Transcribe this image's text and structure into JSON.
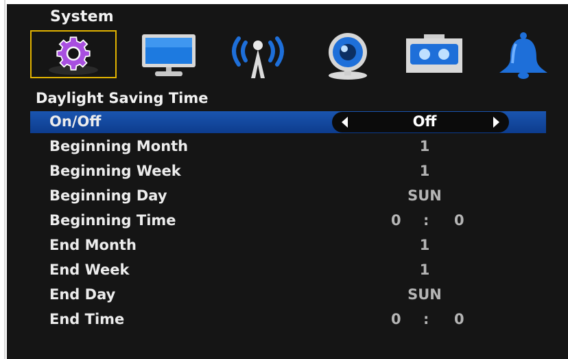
{
  "header": {
    "title": "System"
  },
  "icons": [
    {
      "name": "settings-gear-icon",
      "selected": true
    },
    {
      "name": "monitor-icon",
      "selected": false
    },
    {
      "name": "network-antenna-icon",
      "selected": false
    },
    {
      "name": "webcam-icon",
      "selected": false
    },
    {
      "name": "storage-device-icon",
      "selected": false
    },
    {
      "name": "alarm-bell-icon",
      "selected": false
    }
  ],
  "section": {
    "title": "Daylight Saving Time"
  },
  "rows": [
    {
      "label": "On/Off",
      "value": "Off",
      "selected": true
    },
    {
      "label": "Beginning Month",
      "value": "1"
    },
    {
      "label": "Beginning Week",
      "value": "1"
    },
    {
      "label": "Beginning Day",
      "value": "SUN"
    },
    {
      "label": "Beginning Time",
      "hour": "0",
      "separator": ":",
      "minute": "0"
    },
    {
      "label": "End Month",
      "value": "1"
    },
    {
      "label": "End Week",
      "value": "1"
    },
    {
      "label": "End Day",
      "value": "SUN"
    },
    {
      "label": "End Time",
      "hour": "0",
      "separator": ":",
      "minute": "0"
    }
  ],
  "colors": {
    "background": "#151515",
    "highlight": "#1a55b0",
    "selected_frame": "#e2b300",
    "icon_blue": "#1e6fd9"
  }
}
